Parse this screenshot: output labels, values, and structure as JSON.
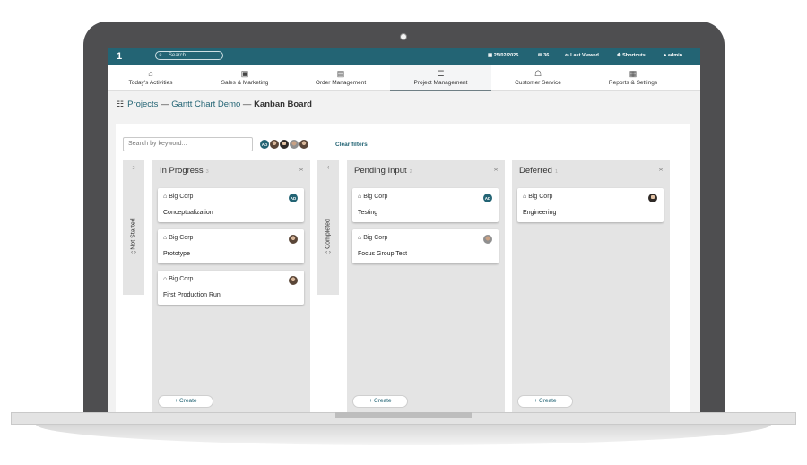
{
  "topbar": {
    "logo": "1",
    "search_placeholder": "Search",
    "date": "25/02/2025",
    "mail_count": "36",
    "last_viewed": "Last Viewed",
    "shortcuts": "Shortcuts",
    "user": "admin"
  },
  "nav": [
    {
      "label": "Today's Activities",
      "icon": "home-icon",
      "glyph": "⌂"
    },
    {
      "label": "Sales & Marketing",
      "icon": "briefcase-icon",
      "glyph": "▣"
    },
    {
      "label": "Order Management",
      "icon": "clipboard-icon",
      "glyph": "▤"
    },
    {
      "label": "Project Management",
      "icon": "tasks-icon",
      "glyph": "☰"
    },
    {
      "label": "Customer Service",
      "icon": "support-icon",
      "glyph": "☖"
    },
    {
      "label": "Reports & Settings",
      "icon": "printer-icon",
      "glyph": "▦"
    }
  ],
  "breadcrumb": {
    "projects": "Projects",
    "sep1": " — ",
    "project": "Gantt Chart Demo",
    "sep2": " — ",
    "current": "Kanban Board"
  },
  "filters": {
    "keyword_placeholder": "Search by keyword...",
    "avatar_initials": "AD",
    "clear": "Clear filters"
  },
  "columns": {
    "not_started": {
      "title": "Not Started",
      "count": "2",
      "arrows": "‹ ›"
    },
    "in_progress": {
      "title": "In Progress",
      "count": "3",
      "toggle": "›‹",
      "cards": [
        {
          "company": "Big Corp",
          "title": "Conceptualization",
          "avatar": "AD"
        },
        {
          "company": "Big Corp",
          "title": "Prototype"
        },
        {
          "company": "Big Corp",
          "title": "First Production Run"
        }
      ],
      "create": "+ Create"
    },
    "completed": {
      "title": "Completed",
      "count": "4",
      "arrows": "‹ ›"
    },
    "pending_input": {
      "title": "Pending Input",
      "count": "2",
      "toggle": "›‹",
      "cards": [
        {
          "company": "Big Corp",
          "title": "Testing",
          "avatar": "AD"
        },
        {
          "company": "Big Corp",
          "title": "Focus Group Test"
        }
      ],
      "create": "+ Create"
    },
    "deferred": {
      "title": "Deferred",
      "count": "1",
      "toggle": "›‹",
      "cards": [
        {
          "company": "Big Corp",
          "title": "Engineering"
        }
      ],
      "create": "+ Create"
    }
  },
  "colors": {
    "topbar": "#236474",
    "accent": "#236474",
    "column_bg": "#e4e4e4"
  }
}
